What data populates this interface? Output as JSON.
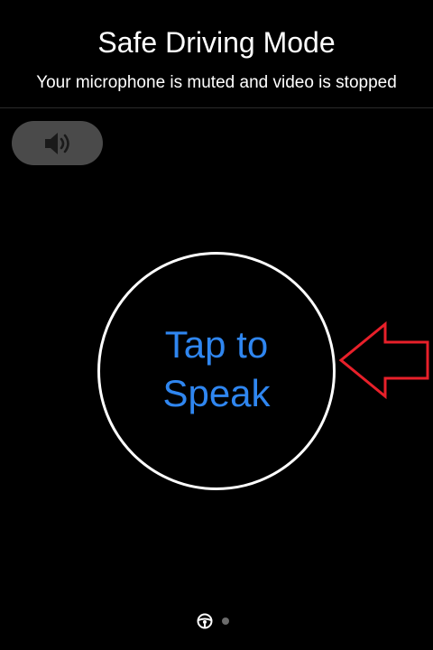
{
  "header": {
    "title": "Safe Driving Mode",
    "subtitle": "Your microphone is muted and video is stopped"
  },
  "speaker_button": {
    "icon": "speaker-icon"
  },
  "speak": {
    "line1": "Tap to",
    "line2": "Speak"
  },
  "annotation": {
    "icon": "arrow-left-icon",
    "color": "#e8202a"
  },
  "page_indicator": {
    "icons": [
      "steering-wheel-icon",
      "page-dot"
    ],
    "active_index": 0
  },
  "colors": {
    "accent": "#2f86f0",
    "background": "#000000",
    "button_gray": "#4a4a4a",
    "inactive_dot": "#6b6b6b"
  }
}
